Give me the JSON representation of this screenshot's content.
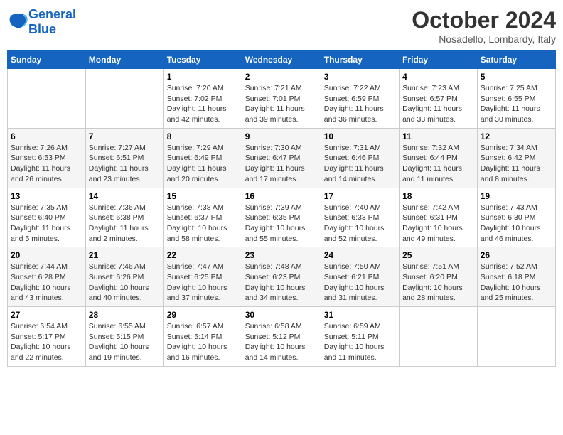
{
  "logo": {
    "text_general": "General",
    "text_blue": "Blue"
  },
  "header": {
    "month": "October 2024",
    "location": "Nosadello, Lombardy, Italy"
  },
  "days_of_week": [
    "Sunday",
    "Monday",
    "Tuesday",
    "Wednesday",
    "Thursday",
    "Friday",
    "Saturday"
  ],
  "weeks": [
    [
      {
        "day": "",
        "info": ""
      },
      {
        "day": "",
        "info": ""
      },
      {
        "day": "1",
        "info": "Sunrise: 7:20 AM\nSunset: 7:02 PM\nDaylight: 11 hours and 42 minutes."
      },
      {
        "day": "2",
        "info": "Sunrise: 7:21 AM\nSunset: 7:01 PM\nDaylight: 11 hours and 39 minutes."
      },
      {
        "day": "3",
        "info": "Sunrise: 7:22 AM\nSunset: 6:59 PM\nDaylight: 11 hours and 36 minutes."
      },
      {
        "day": "4",
        "info": "Sunrise: 7:23 AM\nSunset: 6:57 PM\nDaylight: 11 hours and 33 minutes."
      },
      {
        "day": "5",
        "info": "Sunrise: 7:25 AM\nSunset: 6:55 PM\nDaylight: 11 hours and 30 minutes."
      }
    ],
    [
      {
        "day": "6",
        "info": "Sunrise: 7:26 AM\nSunset: 6:53 PM\nDaylight: 11 hours and 26 minutes."
      },
      {
        "day": "7",
        "info": "Sunrise: 7:27 AM\nSunset: 6:51 PM\nDaylight: 11 hours and 23 minutes."
      },
      {
        "day": "8",
        "info": "Sunrise: 7:29 AM\nSunset: 6:49 PM\nDaylight: 11 hours and 20 minutes."
      },
      {
        "day": "9",
        "info": "Sunrise: 7:30 AM\nSunset: 6:47 PM\nDaylight: 11 hours and 17 minutes."
      },
      {
        "day": "10",
        "info": "Sunrise: 7:31 AM\nSunset: 6:46 PM\nDaylight: 11 hours and 14 minutes."
      },
      {
        "day": "11",
        "info": "Sunrise: 7:32 AM\nSunset: 6:44 PM\nDaylight: 11 hours and 11 minutes."
      },
      {
        "day": "12",
        "info": "Sunrise: 7:34 AM\nSunset: 6:42 PM\nDaylight: 11 hours and 8 minutes."
      }
    ],
    [
      {
        "day": "13",
        "info": "Sunrise: 7:35 AM\nSunset: 6:40 PM\nDaylight: 11 hours and 5 minutes."
      },
      {
        "day": "14",
        "info": "Sunrise: 7:36 AM\nSunset: 6:38 PM\nDaylight: 11 hours and 2 minutes."
      },
      {
        "day": "15",
        "info": "Sunrise: 7:38 AM\nSunset: 6:37 PM\nDaylight: 10 hours and 58 minutes."
      },
      {
        "day": "16",
        "info": "Sunrise: 7:39 AM\nSunset: 6:35 PM\nDaylight: 10 hours and 55 minutes."
      },
      {
        "day": "17",
        "info": "Sunrise: 7:40 AM\nSunset: 6:33 PM\nDaylight: 10 hours and 52 minutes."
      },
      {
        "day": "18",
        "info": "Sunrise: 7:42 AM\nSunset: 6:31 PM\nDaylight: 10 hours and 49 minutes."
      },
      {
        "day": "19",
        "info": "Sunrise: 7:43 AM\nSunset: 6:30 PM\nDaylight: 10 hours and 46 minutes."
      }
    ],
    [
      {
        "day": "20",
        "info": "Sunrise: 7:44 AM\nSunset: 6:28 PM\nDaylight: 10 hours and 43 minutes."
      },
      {
        "day": "21",
        "info": "Sunrise: 7:46 AM\nSunset: 6:26 PM\nDaylight: 10 hours and 40 minutes."
      },
      {
        "day": "22",
        "info": "Sunrise: 7:47 AM\nSunset: 6:25 PM\nDaylight: 10 hours and 37 minutes."
      },
      {
        "day": "23",
        "info": "Sunrise: 7:48 AM\nSunset: 6:23 PM\nDaylight: 10 hours and 34 minutes."
      },
      {
        "day": "24",
        "info": "Sunrise: 7:50 AM\nSunset: 6:21 PM\nDaylight: 10 hours and 31 minutes."
      },
      {
        "day": "25",
        "info": "Sunrise: 7:51 AM\nSunset: 6:20 PM\nDaylight: 10 hours and 28 minutes."
      },
      {
        "day": "26",
        "info": "Sunrise: 7:52 AM\nSunset: 6:18 PM\nDaylight: 10 hours and 25 minutes."
      }
    ],
    [
      {
        "day": "27",
        "info": "Sunrise: 6:54 AM\nSunset: 5:17 PM\nDaylight: 10 hours and 22 minutes."
      },
      {
        "day": "28",
        "info": "Sunrise: 6:55 AM\nSunset: 5:15 PM\nDaylight: 10 hours and 19 minutes."
      },
      {
        "day": "29",
        "info": "Sunrise: 6:57 AM\nSunset: 5:14 PM\nDaylight: 10 hours and 16 minutes."
      },
      {
        "day": "30",
        "info": "Sunrise: 6:58 AM\nSunset: 5:12 PM\nDaylight: 10 hours and 14 minutes."
      },
      {
        "day": "31",
        "info": "Sunrise: 6:59 AM\nSunset: 5:11 PM\nDaylight: 10 hours and 11 minutes."
      },
      {
        "day": "",
        "info": ""
      },
      {
        "day": "",
        "info": ""
      }
    ]
  ]
}
